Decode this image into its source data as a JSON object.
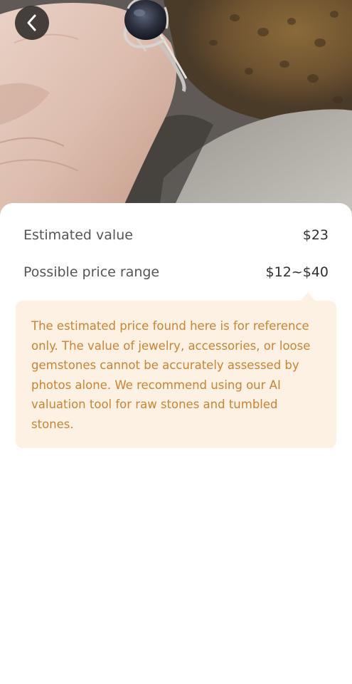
{
  "header": {
    "back_icon": "chevron-left-icon"
  },
  "photo": {
    "subject": "ring-photo"
  },
  "valuation": {
    "estimated_label": "Estimated value",
    "estimated_value": "$23",
    "range_label": "Possible price range",
    "range_value": "$12~$40"
  },
  "note": {
    "text": "The estimated price found here is for reference only. The value of jewelry, accessories, or loose gemstones cannot be accurately assessed by photos alone. We recommend using our AI valuation tool for raw stones and tumbled stones."
  },
  "colors": {
    "note_background": "#fdf1e3",
    "note_text": "#c88433",
    "back_button": "#282624"
  }
}
